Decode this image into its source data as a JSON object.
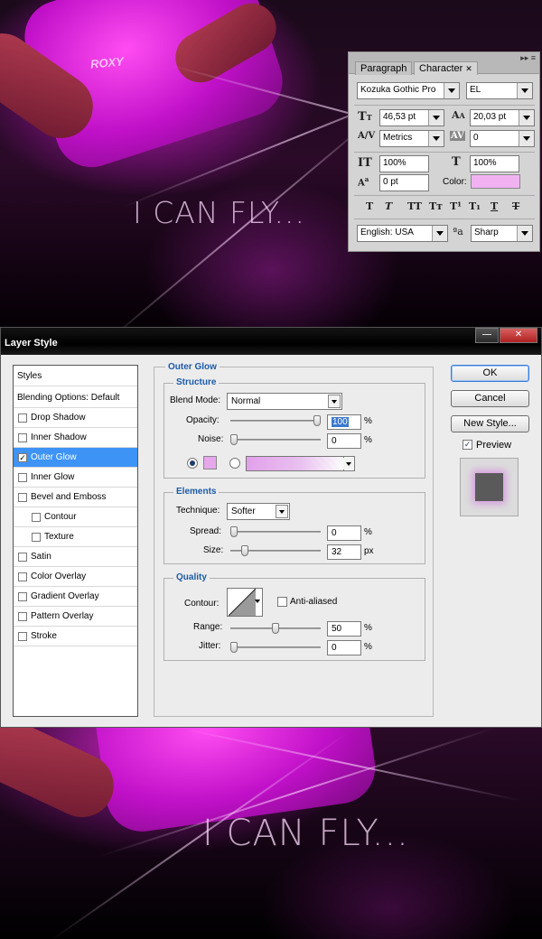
{
  "background": {
    "tagline_top": "I CAN FLY...",
    "tagline_bottom": "I CAN FLY...",
    "shirt_logo": "ROXY",
    "accent_color": "#e020e0"
  },
  "character_panel": {
    "tabs": [
      {
        "label": "Paragraph",
        "active": false
      },
      {
        "label": "Character",
        "active": true
      }
    ],
    "close_glyph": "✕",
    "menu_glyph": "▸▸ ≡",
    "font_family": "Kozuka Gothic Pro",
    "font_style": "EL",
    "font_size": "46,53 pt",
    "leading": "20,03 pt",
    "kerning": "Metrics",
    "tracking": "0",
    "vertical_scale": "100%",
    "horizontal_scale": "100%",
    "baseline_shift": "0 pt",
    "color_label": "Color:",
    "color_value": "#f2b2f2",
    "style_buttons": [
      "T",
      "T",
      "TT",
      "Tт",
      "T¹",
      "T₁",
      "T",
      "T"
    ],
    "language": "English: USA",
    "aa_label": "ªa",
    "antialias": "Sharp"
  },
  "layer_style": {
    "title": "Layer Style",
    "window_buttons": {
      "minimize": "—",
      "close": "✕"
    },
    "styles_list": [
      {
        "label": "Styles",
        "type": "head"
      },
      {
        "label": "Blending Options: Default",
        "type": "head"
      },
      {
        "label": "Drop Shadow",
        "checked": false,
        "indent": false,
        "selected": false
      },
      {
        "label": "Inner Shadow",
        "checked": false,
        "indent": false,
        "selected": false
      },
      {
        "label": "Outer Glow",
        "checked": true,
        "indent": false,
        "selected": true
      },
      {
        "label": "Inner Glow",
        "checked": false,
        "indent": false,
        "selected": false
      },
      {
        "label": "Bevel and Emboss",
        "checked": false,
        "indent": false,
        "selected": false
      },
      {
        "label": "Contour",
        "checked": false,
        "indent": true,
        "selected": false
      },
      {
        "label": "Texture",
        "checked": false,
        "indent": true,
        "selected": false
      },
      {
        "label": "Satin",
        "checked": false,
        "indent": false,
        "selected": false
      },
      {
        "label": "Color Overlay",
        "checked": false,
        "indent": false,
        "selected": false
      },
      {
        "label": "Gradient Overlay",
        "checked": false,
        "indent": false,
        "selected": false
      },
      {
        "label": "Pattern Overlay",
        "checked": false,
        "indent": false,
        "selected": false
      },
      {
        "label": "Stroke",
        "checked": false,
        "indent": false,
        "selected": false
      }
    ],
    "section_title": "Outer Glow",
    "structure": {
      "title": "Structure",
      "blend_mode_label": "Blend Mode:",
      "blend_mode": "Normal",
      "opacity_label": "Opacity:",
      "opacity": "100",
      "opacity_level": 1.0,
      "noise_label": "Noise:",
      "noise": "0",
      "noise_level": 0.0,
      "percent": "%",
      "glow_color": "#e6a7ec",
      "use_color": true
    },
    "elements": {
      "title": "Elements",
      "technique_label": "Technique:",
      "technique": "Softer",
      "spread_label": "Spread:",
      "spread": "0",
      "spread_level": 0.0,
      "size_label": "Size:",
      "size": "32",
      "size_level": 0.13,
      "px": "px",
      "percent": "%"
    },
    "quality": {
      "title": "Quality",
      "contour_label": "Contour:",
      "anti_aliased_label": "Anti-aliased",
      "anti_aliased": false,
      "range_label": "Range:",
      "range": "50",
      "range_level": 0.5,
      "jitter_label": "Jitter:",
      "jitter": "0",
      "jitter_level": 0.0,
      "percent": "%"
    },
    "buttons": {
      "ok": "OK",
      "cancel": "Cancel",
      "new_style": "New Style...",
      "preview_label": "Preview",
      "preview_checked": true
    }
  }
}
